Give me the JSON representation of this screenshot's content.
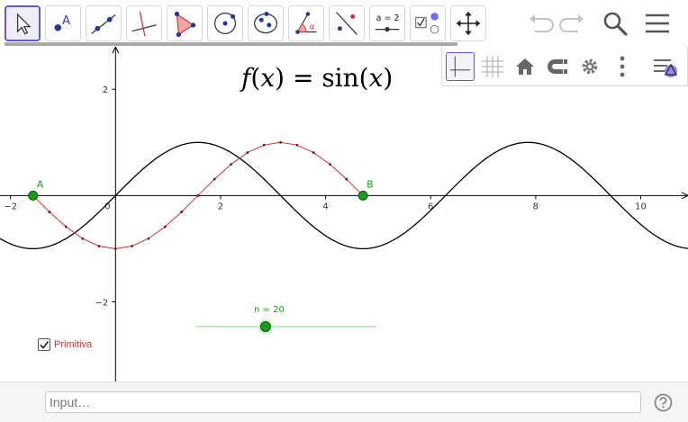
{
  "toolbar": {
    "tools": [
      {
        "name": "move-tool",
        "selected": true
      },
      {
        "name": "point-tool",
        "label": "A"
      },
      {
        "name": "line-tool"
      },
      {
        "name": "perpendicular-line-tool"
      },
      {
        "name": "polygon-tool"
      },
      {
        "name": "circle-center-point-tool"
      },
      {
        "name": "ellipse-tool"
      },
      {
        "name": "angle-tool",
        "label": "α"
      },
      {
        "name": "reflect-tool"
      },
      {
        "name": "slider-tool",
        "label": "a = 2"
      },
      {
        "name": "checkbox-tool"
      },
      {
        "name": "move-graphics-view-tool"
      }
    ],
    "right_icons": [
      "undo-icon",
      "redo-icon",
      "search-icon",
      "menu-icon"
    ]
  },
  "style_bar": {
    "buttons": [
      "axes-toggle",
      "grid-toggle",
      "standard-view-home",
      "view-magnet",
      "graphics-settings",
      "more-options",
      "style-bar-toggle"
    ]
  },
  "graphics": {
    "formula": {
      "f": "f",
      "open": "(",
      "x": "x",
      "close": ")",
      "eq": " = ",
      "fn": "sin",
      "open2": "(",
      "x2": "x",
      "close2": ")"
    },
    "points": [
      {
        "label": "A",
        "x": -1.5708,
        "y": 0
      },
      {
        "label": "B",
        "x": 4.7124,
        "y": 0
      }
    ],
    "slider": {
      "label": "n = 20",
      "name": "n",
      "value": 20,
      "min": 1,
      "max": 50
    },
    "checkbox": {
      "label": "Primitiva",
      "checked": true
    },
    "colors": {
      "function": "#000000",
      "primitive": "#d32f2f",
      "points": "#1a9b1a",
      "slider_line": "#a6dba6",
      "axis": "#000000",
      "selection": "#6557d2"
    }
  },
  "chart_data": {
    "type": "line",
    "title": "",
    "xlabel": "",
    "ylabel": "",
    "xlim": [
      -2.2,
      10.9
    ],
    "ylim": [
      -3.5,
      2.8
    ],
    "grid": false,
    "x_ticks": [
      -2,
      0,
      2,
      4,
      6,
      8,
      10
    ],
    "y_ticks": [
      -2,
      2
    ],
    "tick_labels_x": [
      "−2",
      "0",
      "2",
      "4",
      "6",
      "8",
      "10"
    ],
    "tick_labels_y": [
      "−2",
      "2"
    ],
    "series": [
      {
        "function": "sin(x)",
        "x_range": [
          -2.2,
          10.9
        ]
      },
      {
        "function": "-cos(x)",
        "x_range": [
          -1.5708,
          4.7124
        ],
        "samples": 20,
        "markers": true
      }
    ]
  },
  "input_bar": {
    "placeholder": "Input…"
  }
}
